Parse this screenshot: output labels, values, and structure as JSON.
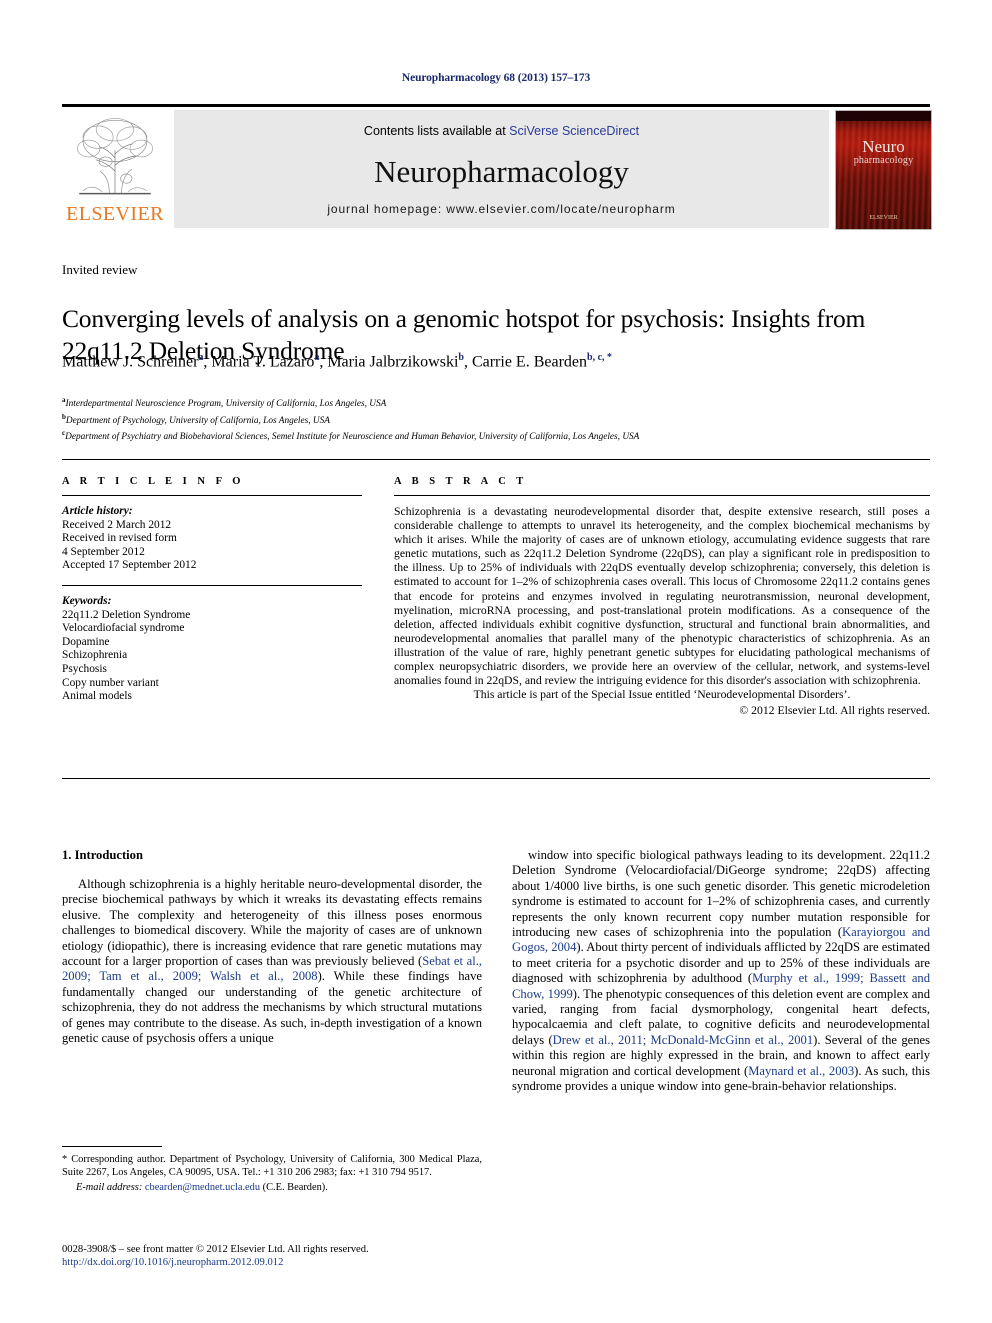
{
  "running_head": "Neuropharmacology 68 (2013) 157–173",
  "masthead": {
    "contents_prefix": "Contents lists available at ",
    "contents_link": "SciVerse ScienceDirect",
    "journal_title": "Neuropharmacology",
    "homepage": "journal homepage: www.elsevier.com/locate/neuropharm",
    "publisher_logo_text": "ELSEVIER",
    "cover": {
      "line1": "Neuro",
      "line2": "pharmacology",
      "seal": "ELSEVIER"
    }
  },
  "article": {
    "type_label": "Invited review",
    "title": "Converging levels of analysis on a genomic hotspot for psychosis: Insights from 22q11.2 Deletion Syndrome",
    "authors": [
      {
        "name": "Matthew J. Schreiner",
        "sup": "a"
      },
      {
        "name": "Maria T. Lazaro",
        "sup": "a"
      },
      {
        "name": "Maria Jalbrzikowski",
        "sup": "b"
      },
      {
        "name": "Carrie E. Bearden",
        "sup": "b, c, *"
      }
    ],
    "affiliations": [
      {
        "mark": "a",
        "text": "Interdepartmental Neuroscience Program, University of California, Los Angeles, USA"
      },
      {
        "mark": "b",
        "text": "Department of Psychology, University of California, Los Angeles, USA"
      },
      {
        "mark": "c",
        "text": "Department of Psychiatry and Biobehavioral Sciences, Semel Institute for Neuroscience and Human Behavior, University of California, Los Angeles, USA"
      }
    ]
  },
  "info": {
    "heading": "A R T I C L E   I N F O",
    "history_label": "Article history:",
    "history": [
      "Received 2 March 2012",
      "Received in revised form",
      "4 September 2012",
      "Accepted 17 September 2012"
    ],
    "keywords_label": "Keywords:",
    "keywords": [
      "22q11.2 Deletion Syndrome",
      "Velocardiofacial syndrome",
      "Dopamine",
      "Schizophrenia",
      "Psychosis",
      "Copy number variant",
      "Animal models"
    ]
  },
  "abstract": {
    "heading": "A B S T R A C T",
    "text": "Schizophrenia is a devastating neurodevelopmental disorder that, despite extensive research, still poses a considerable challenge to attempts to unravel its heterogeneity, and the complex biochemical mechanisms by which it arises. While the majority of cases are of unknown etiology, accumulating evidence suggests that rare genetic mutations, such as 22q11.2 Deletion Syndrome (22qDS), can play a significant role in predisposition to the illness. Up to 25% of individuals with 22qDS eventually develop schizophrenia; conversely, this deletion is estimated to account for 1–2% of schizophrenia cases overall. This locus of Chromosome 22q11.2 contains genes that encode for proteins and enzymes involved in regulating neurotransmission, neuronal development, myelination, microRNA processing, and post-translational protein modifications. As a consequence of the deletion, affected individuals exhibit cognitive dysfunction, structural and functional brain abnormalities, and neurodevelopmental anomalies that parallel many of the phenotypic characteristics of schizophrenia. As an illustration of the value of rare, highly penetrant genetic subtypes for elucidating pathological mechanisms of complex neuropsychiatric disorders, we provide here an overview of the cellular, network, and systems-level anomalies found in 22qDS, and review the intriguing evidence for this disorder's association with schizophrenia.",
    "special_issue": "This article is part of the Special Issue entitled ‘Neurodevelopmental Disorders’.",
    "copyright": "© 2012 Elsevier Ltd. All rights reserved."
  },
  "body": {
    "section_number_title": "1.  Introduction",
    "left_paragraph_part1": "Although schizophrenia is a highly heritable neuro-developmental disorder, the precise biochemical pathways by which it wreaks its devastating effects remains elusive. The complexity and heterogeneity of this illness poses enormous challenges to biomedical discovery. While the majority of cases are of unknown etiology (idiopathic), there is increasing evidence that rare genetic mutations may account for a larger proportion of cases than was previously believed (",
    "left_ref1": "Sebat et al., 2009; Tam et al., 2009; Walsh et al., 2008",
    "left_paragraph_part2": "). While these findings have fundamentally changed our understanding of the genetic architecture of schizophrenia, they do not address the mechanisms by which structural mutations of genes may contribute to the disease. As such, in-depth investigation of a known genetic cause of psychosis offers a unique",
    "right_part1": "window into specific biological pathways leading to its development. 22q11.2 Deletion Syndrome (Velocardiofacial/DiGeorge syndrome; 22qDS) affecting about 1/4000 live births, is one such genetic disorder. This genetic microdeletion syndrome is estimated to account for 1–2% of schizophrenia cases, and currently represents the only known recurrent copy number mutation responsible for introducing new cases of schizophrenia into the population (",
    "right_ref1": "Karayiorgou and Gogos, 2004",
    "right_part2": "). About thirty percent of individuals afflicted by 22qDS are estimated to meet criteria for a psychotic disorder and up to 25% of these individuals are diagnosed with schizophrenia by adulthood (",
    "right_ref2": "Murphy et al., 1999; Bassett and Chow, 1999",
    "right_part3": "). The phenotypic consequences of this deletion event are complex and varied, ranging from facial dysmorphology, congenital heart defects, hypocalcaemia and cleft palate, to cognitive deficits and neurodevelopmental delays (",
    "right_ref3": "Drew et al., 2011; McDonald-McGinn et al., 2001",
    "right_part4": "). Several of the genes within this region are highly expressed in the brain, and known to affect early neuronal migration and cortical development (",
    "right_ref4": "Maynard et al., 2003",
    "right_part5": "). As such, this syndrome provides a unique window into gene-brain-behavior relationships."
  },
  "footnote": {
    "corresponding": "* Corresponding author. Department of Psychology, University of California, 300 Medical Plaza, Suite 2267, Los Angeles, CA 90095, USA. Tel.: +1 310 206 2983; fax: +1 310 794 9517.",
    "email_label": "E-mail address:",
    "email": "cbearden@mednet.ucla.edu",
    "email_suffix": " (C.E. Bearden)."
  },
  "imprint": {
    "issn_line": "0028-3908/$ – see front matter © 2012 Elsevier Ltd. All rights reserved.",
    "doi": "http://dx.doi.org/10.1016/j.neuropharm.2012.09.012"
  },
  "colors": {
    "link_blue": "#1b3a87",
    "sciencedirect_blue": "#2b3c9b",
    "elsevier_orange": "#E87722",
    "masthead_gray": "#e8e8e8"
  }
}
